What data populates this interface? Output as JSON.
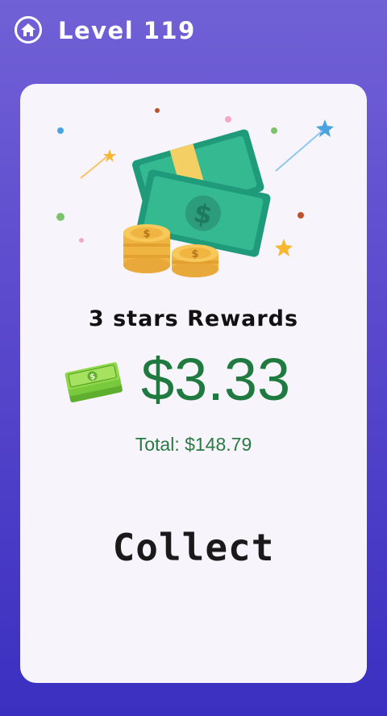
{
  "header": {
    "level_label": "Level 119",
    "home_icon": "home-icon"
  },
  "reward_card": {
    "title": "3 stars Rewards",
    "amount": "$3.33",
    "total": "Total: $148.79",
    "collect_label": "Collect"
  },
  "colors": {
    "background_top": "#7161d6",
    "background_bottom": "#3a2fc0",
    "card": "#f8f4fc",
    "money_green": "#1f7a3f"
  }
}
